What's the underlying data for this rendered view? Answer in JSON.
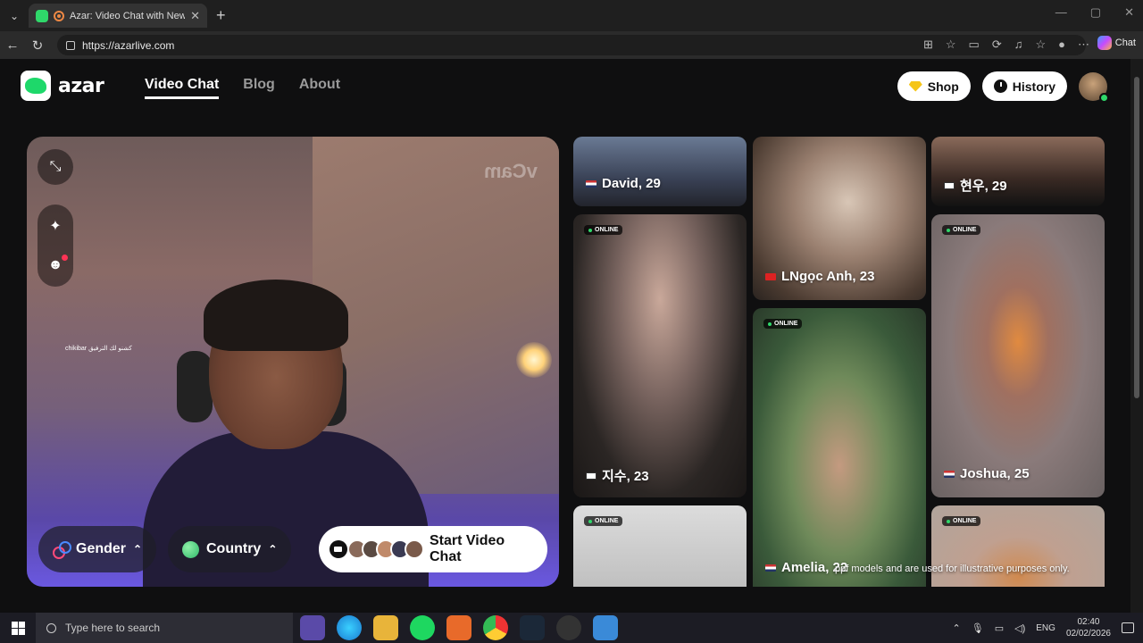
{
  "browser": {
    "tab_title": "Azar: Video Chat with New Pe",
    "tab_close": "✕",
    "new_tab": "+",
    "url": "https://azarlive.com",
    "copilot_label": "Chat",
    "window_controls": [
      "—",
      "▢",
      "✕"
    ]
  },
  "header": {
    "logo_text": "azar",
    "nav": [
      {
        "label": "Video Chat",
        "active": true
      },
      {
        "label": "Blog",
        "active": false
      },
      {
        "label": "About",
        "active": false
      }
    ],
    "shop_label": "Shop",
    "history_label": "History"
  },
  "camera": {
    "watermark": "vCam",
    "overlay_text": "chikibar كشنو لك الترفيق",
    "gender_label": "Gender",
    "country_label": "Country",
    "start_label": "Start Video Chat",
    "chevron": "⌃"
  },
  "gallery": {
    "cards": [
      {
        "name": "David, 29",
        "flag": "us",
        "online": false
      },
      {
        "name": "LNgọc Anh, 23",
        "flag": "vn",
        "online": false
      },
      {
        "name": "현우, 29",
        "flag": "kr",
        "online": false
      },
      {
        "name": "지수, 23",
        "flag": "kr",
        "online": true
      },
      {
        "name": "Amelia, 22",
        "flag": "us",
        "online": true
      },
      {
        "name": "Joshua, 25",
        "flag": "us",
        "online": true
      },
      {
        "name": "",
        "flag": "",
        "online": true
      },
      {
        "name": "",
        "flag": "",
        "online": true
      }
    ],
    "online_label": "ONLINE",
    "disclaimer": "ppf models and are used for illustrative purposes only."
  },
  "taskbar": {
    "search_placeholder": "Type here to search",
    "lang": "ENG",
    "time": "02:40",
    "date": "02/02/2026"
  },
  "colors": {
    "brand_green": "#1ed86a",
    "page_bg": "#0f0f10",
    "online_green": "#2fd86a"
  }
}
